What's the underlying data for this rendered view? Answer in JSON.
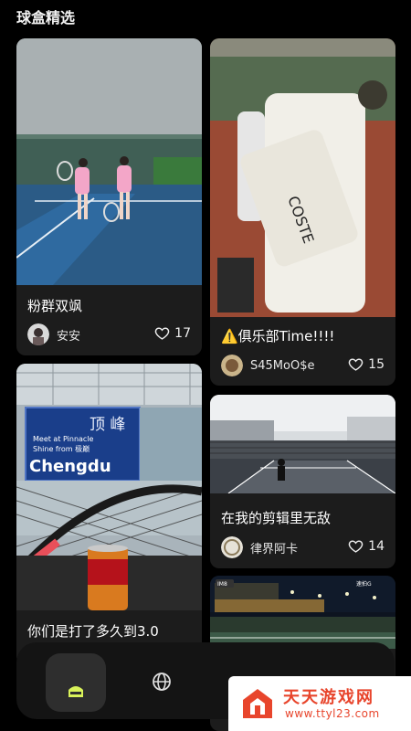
{
  "section": {
    "title": "球盒精选"
  },
  "cards": [
    {
      "title": "粉群双飒",
      "author": "安安",
      "likes": "17"
    },
    {
      "title": "⚠️俱乐部Time!!!!",
      "author": "S45MoO$e",
      "likes": "15"
    },
    {
      "title": "你们是打了多久到3.0",
      "author": "",
      "likes": ""
    },
    {
      "title": "在我的剪辑里无敌",
      "author": "律界阿卡",
      "likes": "14"
    },
    {
      "title": "",
      "author": "",
      "likes": ""
    }
  ],
  "banner": {
    "line1": "Meet at Pinnacle",
    "line2": "Shine from 极巅",
    "city": "Chengdu",
    "big_chars": "顶 峰"
  },
  "photo_badges": {
    "left": "IM8",
    "right": "速拍G"
  },
  "tabbar": {
    "tabs": [
      {
        "icon": "home-icon"
      },
      {
        "icon": "globe-icon"
      }
    ]
  },
  "watermark": {
    "name": "天天游戏网",
    "url": "www.ttyl23.com"
  },
  "colors": {
    "background": "#000000",
    "card": "#1c1c1c",
    "watermark": "#e8452c",
    "home_icon": "#d9f25a"
  }
}
